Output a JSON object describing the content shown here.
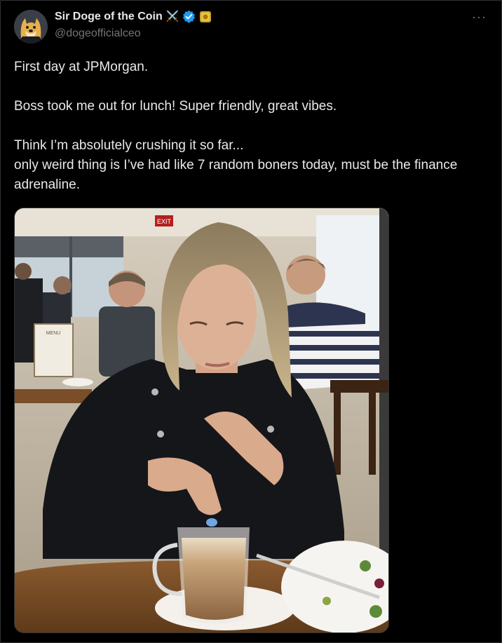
{
  "author": {
    "name": "Sir Doge of the Coin",
    "handle": "@dogeofficialceo",
    "badges": [
      "crossed-swords-icon",
      "verified-icon",
      "gold-coin-icon"
    ]
  },
  "menu": {
    "more_label": "···"
  },
  "tweet": {
    "line1": "First day at JPMorgan.",
    "line2": "Boss took me out for lunch! Super friendly, great vibes.",
    "line3": "Think I’m absolutely crushing it so far...",
    "line4": "only weird thing is I’ve had like 7 random boners today, must be the finance adrenaline."
  },
  "media": {
    "exit_sign": "EXIT",
    "menu_card": "MENU"
  },
  "colors": {
    "background": "#000000",
    "text": "#e7e9ea",
    "muted": "#71767b",
    "verified": "#1d9bf0"
  }
}
